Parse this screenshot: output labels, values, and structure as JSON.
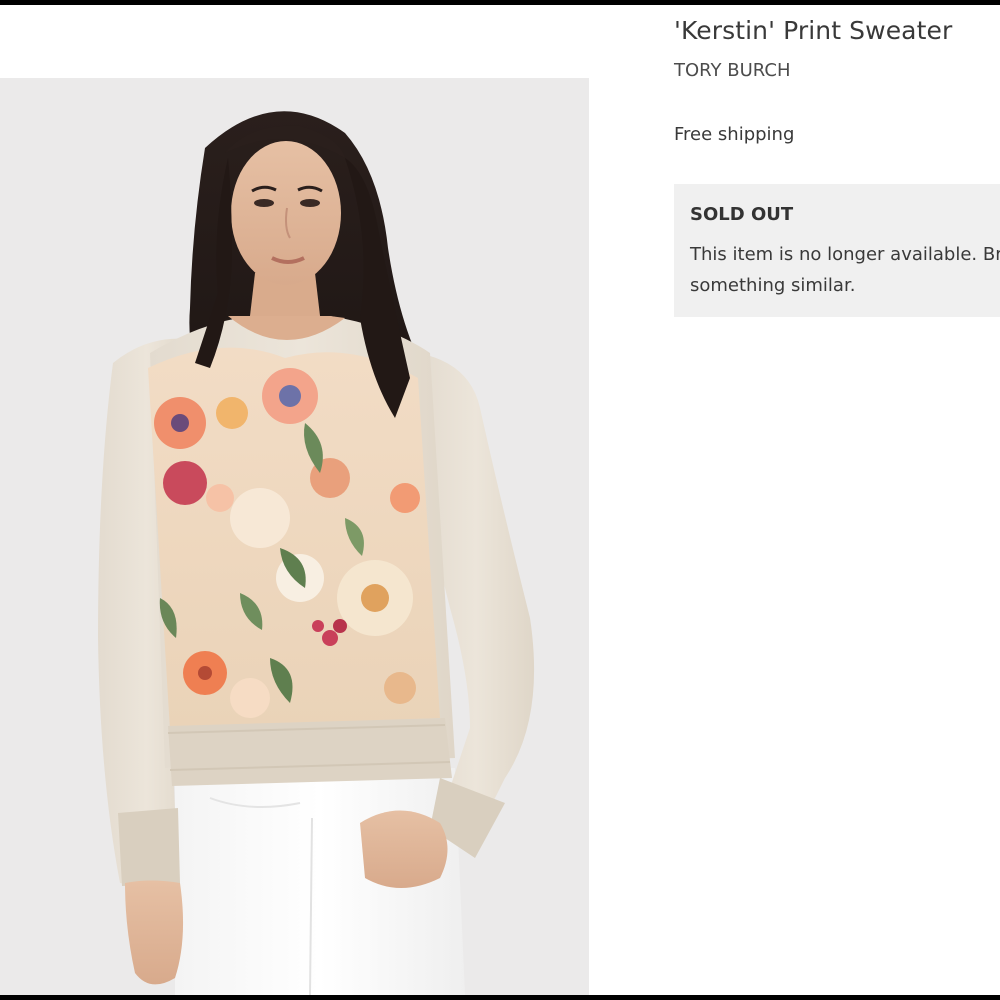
{
  "product": {
    "title": "'Kerstin' Print Sweater",
    "brand": "TORY BURCH",
    "shipping": "Free shipping",
    "status": {
      "title": "SOLD OUT",
      "message": "This item is no longer available. Browse something similar."
    }
  },
  "colors": {
    "page_background": "#ffffff",
    "photo_background": "#ebeaea",
    "status_box": "#f0f0f0",
    "text": "#393939"
  },
  "image": {
    "icon": "product-photo",
    "subject": "model wearing a cream sweater with a floral print front and white jeans"
  }
}
